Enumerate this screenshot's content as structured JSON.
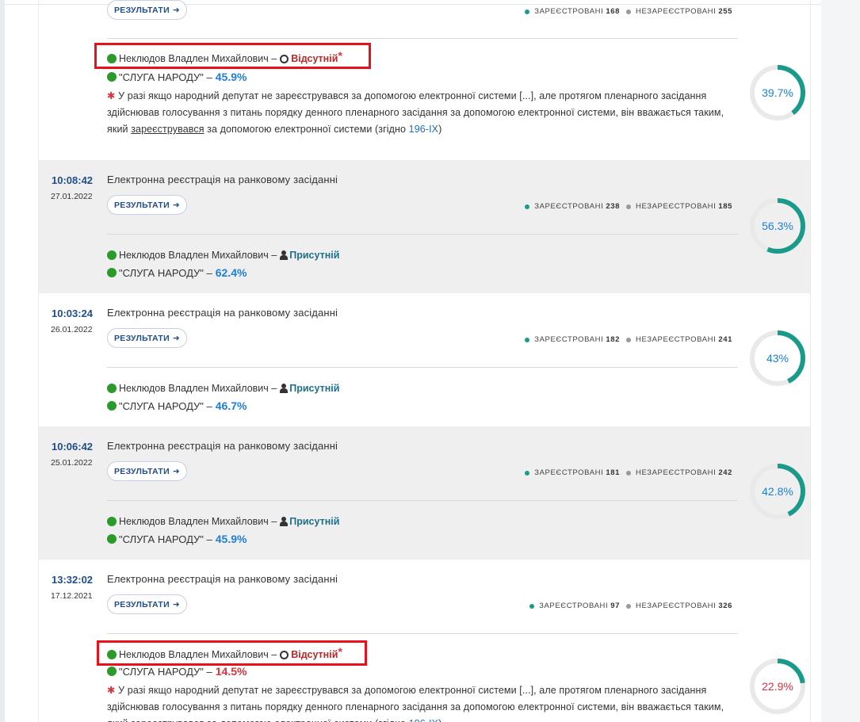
{
  "colors": {
    "teal": "#1a9a8a",
    "ring_bg": "#e9e9e9",
    "red": "#d9333f",
    "blue": "#1e7fd6"
  },
  "common": {
    "results_label": "РЕЗУЛЬТАТИ",
    "registered_label": "ЗАРЕЄСТРОВАНІ",
    "unregistered_label": "НЕЗАРЕЄСТРОВАНІ",
    "title": "Електронна реєстрація на ранковому засіданні",
    "person": "Неклюдов Владлен Михайлович –",
    "party": "\"СЛУГА НАРОДУ\" –",
    "status_absent": "Відсутній",
    "status_present": "Присутній",
    "asterisk": "*",
    "note_part1": "У разі якщо народний депутат не зареєструвався за допомогою електронної системи [...], але протягом пленарного засідання здійснював голосування з питань порядку денного пленарного засідання за допомогою електронної системи, він вважається таким, який",
    "note_link_word": "зареєструвався",
    "note_part2": "за допомогою електронної системи (згідно",
    "note_law": "196-IX",
    "note_end": ")"
  },
  "records": [
    {
      "time": "",
      "date": "",
      "registered": "168",
      "unregistered": "255",
      "status": "absent",
      "party_pct": "45.9%",
      "donut_pct": "39.7%",
      "donut_value": 39.7
    },
    {
      "time": "10:08:42",
      "date": "27.01.2022",
      "registered": "238",
      "unregistered": "185",
      "status": "present",
      "party_pct": "62.4%",
      "donut_pct": "56.3%",
      "donut_value": 56.3
    },
    {
      "time": "10:03:24",
      "date": "26.01.2022",
      "registered": "182",
      "unregistered": "241",
      "status": "present",
      "party_pct": "46.7%",
      "donut_pct": "43%",
      "donut_value": 43
    },
    {
      "time": "10:06:42",
      "date": "25.01.2022",
      "registered": "181",
      "unregistered": "242",
      "status": "present",
      "party_pct": "45.9%",
      "donut_pct": "42.8%",
      "donut_value": 42.8
    },
    {
      "time": "13:32:02",
      "date": "17.12.2021",
      "registered": "97",
      "unregistered": "326",
      "status": "absent",
      "party_pct": "14.5%",
      "donut_pct": "22.9%",
      "donut_value": 22.9
    }
  ]
}
